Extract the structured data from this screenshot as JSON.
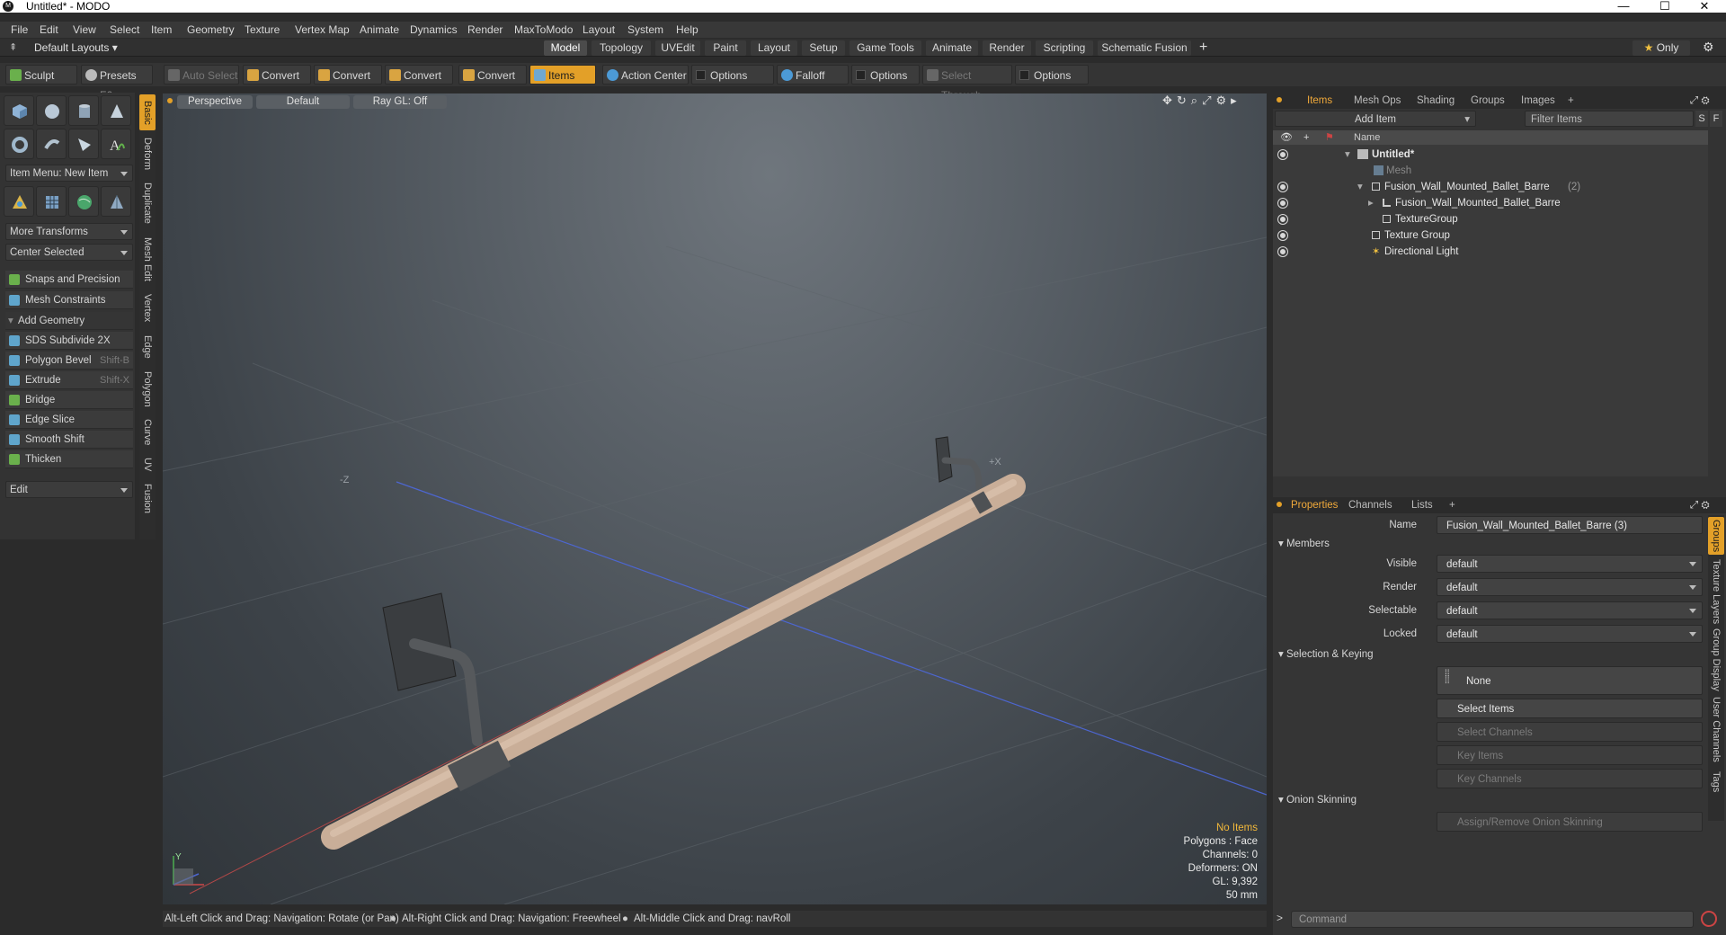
{
  "window": {
    "title": "Untitled* - MODO",
    "logo_text": "M"
  },
  "menu": [
    "File",
    "Edit",
    "View",
    "Select",
    "Item",
    "Geometry",
    "Texture",
    "Vertex Map",
    "Animate",
    "Dynamics",
    "Render",
    "MaxToModo",
    "Layout",
    "System",
    "Help"
  ],
  "layouts": {
    "preset": "Default Layouts",
    "tabs": [
      "Model",
      "Topology",
      "UVEdit",
      "Paint",
      "Layout",
      "Setup",
      "Game Tools",
      "Animate",
      "Render",
      "Scripting",
      "Schematic Fusion"
    ],
    "active": "Model",
    "only_label": "Only"
  },
  "toolbar": {
    "sculpt": "Sculpt",
    "presets": "Presets",
    "presets_key": "F6",
    "auto_select": "Auto Select",
    "convert1": "Convert",
    "convert2": "Convert",
    "convert3": "Convert",
    "convert4": "Convert",
    "items": "Items",
    "action_center": "Action Center",
    "options1": "Options",
    "falloff": "Falloff",
    "options2": "Options",
    "select_through": "Select Through",
    "options3": "Options"
  },
  "left": {
    "item_menu": "Item Menu: New Item",
    "more_transforms": "More Transforms",
    "center_selected": "Center Selected",
    "snaps": "Snaps and Precision",
    "mesh_constraints": "Mesh Constraints",
    "add_geometry": "Add Geometry",
    "tools": [
      {
        "label": "SDS Subdivide 2X",
        "key": ""
      },
      {
        "label": "Polygon Bevel",
        "key": "Shift-B"
      },
      {
        "label": "Extrude",
        "key": "Shift-X"
      },
      {
        "label": "Bridge",
        "key": ""
      },
      {
        "label": "Edge Slice",
        "key": ""
      },
      {
        "label": "Smooth Shift",
        "key": ""
      },
      {
        "label": "Thicken",
        "key": ""
      }
    ],
    "edit": "Edit",
    "side_tabs": [
      "Basic",
      "Deform",
      "Duplicate",
      "Mesh Edit",
      "Vertex",
      "Edge",
      "Polygon",
      "Curve",
      "UV",
      "Fusion"
    ]
  },
  "viewport": {
    "view": "Perspective",
    "shading": "Default",
    "raygl": "Ray GL: Off",
    "axis_z": "-Z",
    "axis_x": "+X",
    "axis_y": "Y",
    "info": {
      "selection": "No Items",
      "polygons": "Polygons : Face",
      "channels": "Channels: 0",
      "deformers": "Deformers: ON",
      "gl": "GL: 9,392",
      "unit": "50 mm"
    }
  },
  "status": {
    "hint1": "Alt-Left Click and Drag: Navigation: Rotate (or Pan)",
    "hint2": "Alt-Right Click and Drag: Navigation: Freewheel",
    "hint3": "Alt-Middle Click and Drag: navRoll"
  },
  "items_panel": {
    "tabs": [
      "Items",
      "Mesh Ops",
      "Shading",
      "Groups",
      "Images"
    ],
    "add_item": "Add Item",
    "filter": "Filter Items",
    "s": "S",
    "f": "F",
    "col_name": "Name",
    "rows": [
      {
        "label": "Untitled*",
        "indent": 0
      },
      {
        "label": "Mesh",
        "indent": 1
      },
      {
        "label": "Fusion_Wall_Mounted_Ballet_Barre",
        "count": "(2)",
        "indent": 1
      },
      {
        "label": "Fusion_Wall_Mounted_Ballet_Barre",
        "indent": 2
      },
      {
        "label": "TextureGroup",
        "indent": 2
      },
      {
        "label": "Texture Group",
        "indent": 1
      },
      {
        "label": "Directional Light",
        "indent": 1
      }
    ]
  },
  "properties": {
    "tabs": [
      "Properties",
      "Channels",
      "Lists"
    ],
    "name_label": "Name",
    "name_value": "Fusion_Wall_Mounted_Ballet_Barre (3)",
    "members": "Members",
    "visible": "Visible",
    "render": "Render",
    "selectable": "Selectable",
    "locked": "Locked",
    "default": "default",
    "selection_keying": "Selection & Keying",
    "none": "None",
    "select_items": "Select Items",
    "select_channels": "Select Channels",
    "key_items": "Key Items",
    "key_channels": "Key Channels",
    "onion": "Onion Skinning",
    "assign_onion": "Assign/Remove Onion Skinning",
    "side_tabs": [
      "Groups",
      "Texture Layers",
      "Group Display",
      "User Channels",
      "Tags"
    ]
  },
  "command": {
    "placeholder": "Command"
  }
}
